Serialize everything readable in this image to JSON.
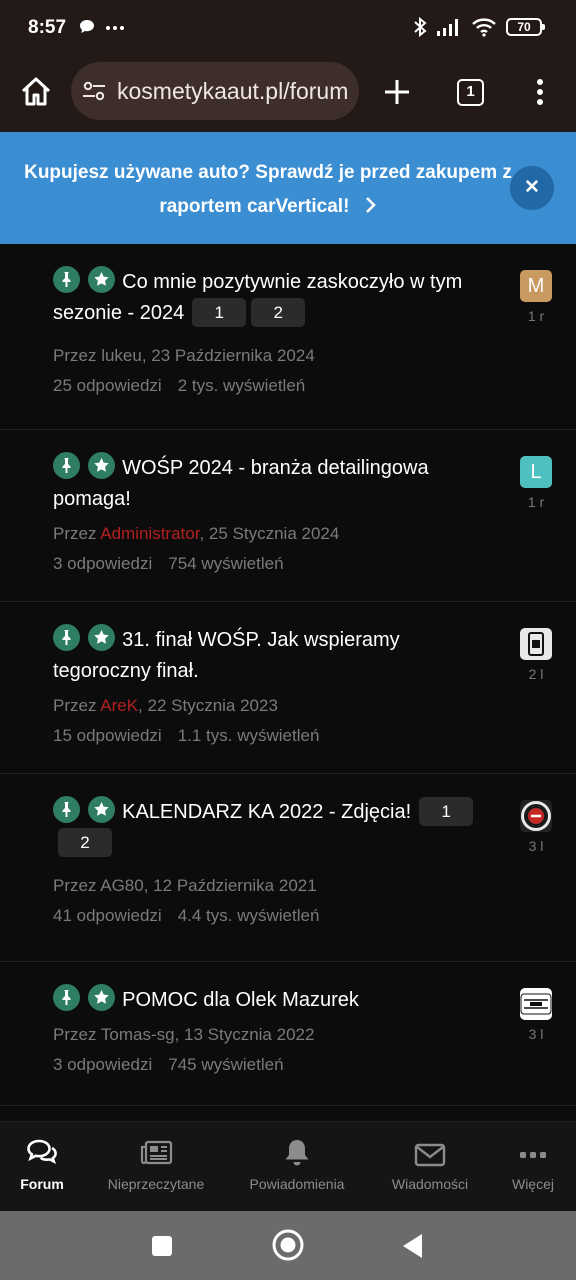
{
  "status_bar": {
    "time": "8:57",
    "left_icons": [
      "chat-bubble-icon",
      "more-dots-icon"
    ],
    "battery": "70"
  },
  "browser": {
    "url": "kosmetykaaut.pl/forum",
    "tab_count": "1"
  },
  "banner": {
    "text": "Kupujesz używane auto? Sprawdź je przed zakupem z raportem carVertical!",
    "color": "#3c8ed3"
  },
  "threads": [
    {
      "title": "Co mnie pozytywnie zaskoczyło w tym sezonie - 2024",
      "pages": [
        "1",
        "2"
      ],
      "meta_prefix": "Przez ",
      "author": "lukeu",
      "meta_date": ", 23 Października 2024",
      "replies": "25 odpowiedzi",
      "views": "2 tys. wyświetleń",
      "avatar_letter": "M",
      "avatar_color": "#c89a60",
      "age": "1 r"
    },
    {
      "title": "WOŚP 2024 - branża detailingowa pomaga!",
      "pages": [],
      "meta_prefix": "Przez ",
      "author": "Administrator",
      "meta_date": ", 25 Stycznia 2024",
      "replies": "3 odpowiedzi",
      "views": "754 wyświetleń",
      "avatar_letter": "L",
      "avatar_color": "#4fc0c0",
      "age": "1 r"
    },
    {
      "title": "31. finał WOŚP. Jak wspieramy tegoroczny finał.",
      "pages": [],
      "meta_prefix": "Przez ",
      "author": "AreK",
      "meta_date": ", 22 Stycznia 2023",
      "replies": "15 odpowiedzi",
      "views": "1.1 tys. wyświetleń",
      "avatar_letter": "",
      "avatar_color": "#e8e8e8",
      "age": "2 l"
    },
    {
      "title": "KALENDARZ KA 2022 - Zdjęcia!",
      "pages": [
        "1",
        "2"
      ],
      "meta_prefix": "Przez ",
      "author": "AG80",
      "meta_date": ", 12 Października 2021",
      "replies": "41 odpowiedzi",
      "views": "4.4 tys. wyświetleń",
      "avatar_letter": "",
      "avatar_color": "#222222",
      "age": "3 l"
    },
    {
      "title": "POMOC dla Olek Mazurek",
      "pages": [],
      "meta_prefix": "Przez ",
      "author": "Tomas-sg",
      "meta_date": ", 13 Stycznia 2022",
      "replies": "3 odpowiedzi",
      "views": "745 wyświetleń",
      "avatar_letter": "",
      "avatar_color": "#ffffff",
      "age": "3 l"
    }
  ],
  "bottom_nav": [
    {
      "label": "Forum",
      "icon": "chat-bubbles-icon",
      "active": true
    },
    {
      "label": "Nieprzeczytane",
      "icon": "newspaper-icon",
      "active": false
    },
    {
      "label": "Powiadomienia",
      "icon": "bell-icon",
      "active": false
    },
    {
      "label": "Wiadomości",
      "icon": "envelope-icon",
      "active": false
    },
    {
      "label": "Więcej",
      "icon": "more-dots-icon",
      "active": false
    }
  ],
  "colors": {
    "accent_green": "#2f7e63",
    "author_red": "#b32020",
    "background": "#0c0c0c"
  }
}
